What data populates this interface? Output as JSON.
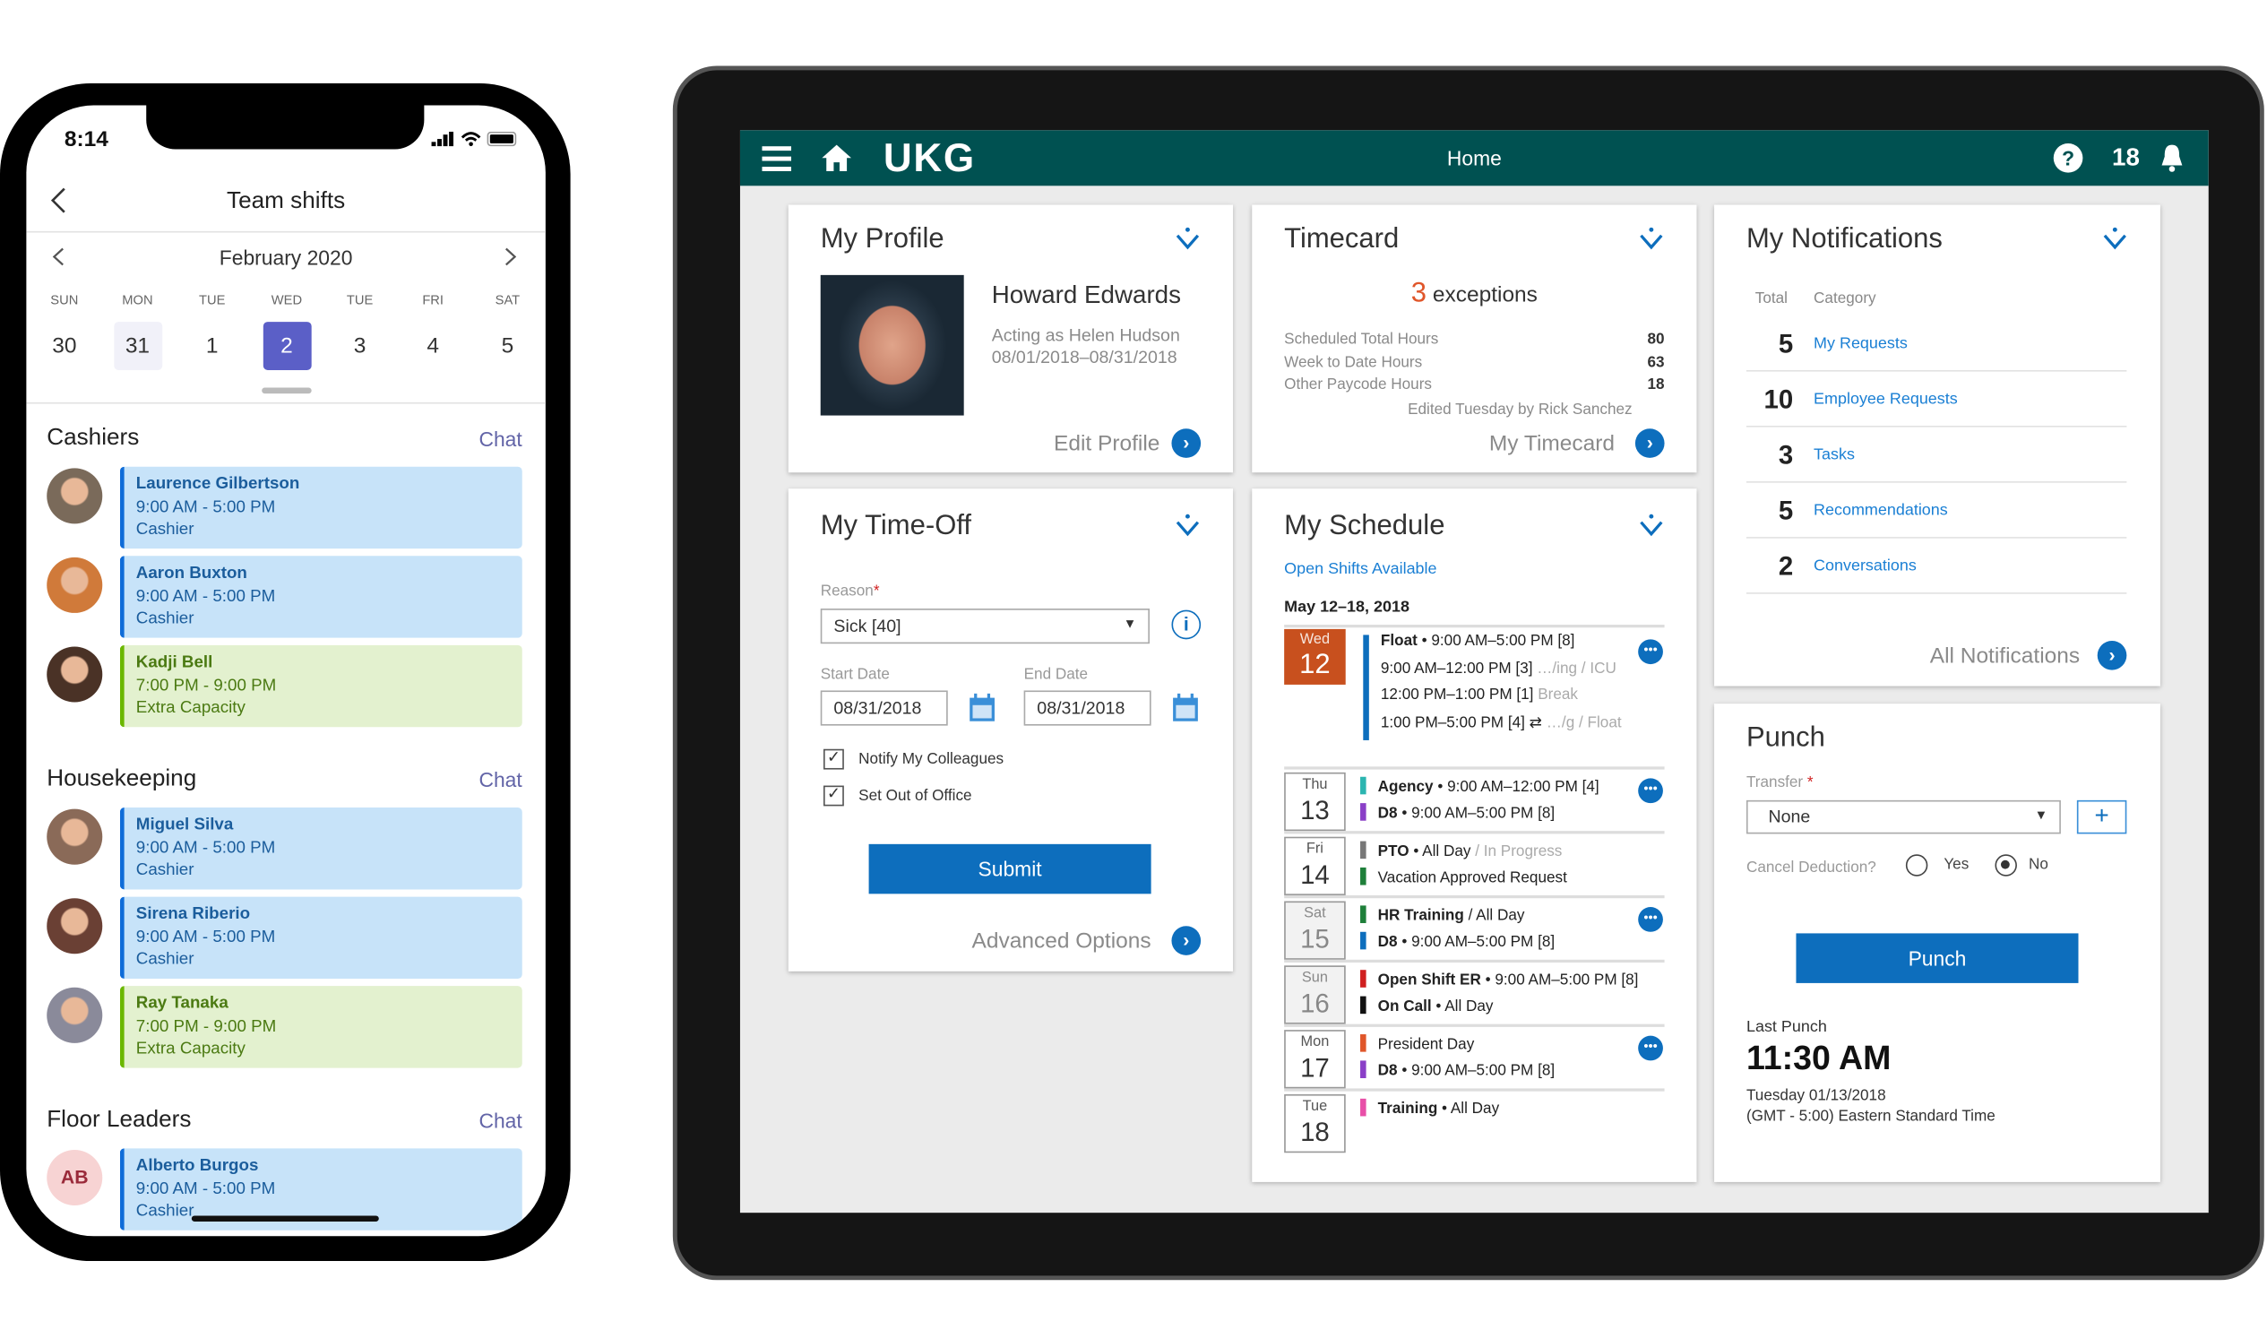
{
  "phone": {
    "status_time": "8:14",
    "title": "Team shifts",
    "month": "February 2020",
    "day_labels": [
      "SUN",
      "MON",
      "TUE",
      "WED",
      "TUE",
      "FRI",
      "SAT"
    ],
    "day_numbers": [
      "30",
      "31",
      "1",
      "2",
      "3",
      "4",
      "5"
    ],
    "selected_day": "2",
    "accent": "#5b5fc7",
    "groups": [
      {
        "name": "Cashiers",
        "chat": "Chat",
        "shifts": [
          {
            "name": "Laurence Gilbertson",
            "time": "9:00 AM - 5:00 PM",
            "role": "Cashier",
            "color": "blue"
          },
          {
            "name": "Aaron Buxton",
            "time": "9:00 AM - 5:00 PM",
            "role": "Cashier",
            "color": "blue"
          },
          {
            "name": "Kadji Bell",
            "time": "7:00 PM - 9:00 PM",
            "role": "Extra Capacity",
            "color": "green"
          }
        ]
      },
      {
        "name": "Housekeeping",
        "chat": "Chat",
        "shifts": [
          {
            "name": "Miguel Silva",
            "time": "9:00 AM - 5:00 PM",
            "role": "Cashier",
            "color": "blue"
          },
          {
            "name": "Sirena Riberio",
            "time": "9:00 AM - 5:00 PM",
            "role": "Cashier",
            "color": "blue"
          },
          {
            "name": "Ray Tanaka",
            "time": "7:00 PM - 9:00 PM",
            "role": "Extra Capacity",
            "color": "green"
          }
        ]
      },
      {
        "name": "Floor Leaders",
        "chat": "Chat",
        "shifts": [
          {
            "name": "Alberto Burgos",
            "time": "9:00 AM - 5:00 PM",
            "role": "Cashier",
            "color": "blue",
            "initials": "AB"
          }
        ]
      }
    ]
  },
  "tablet": {
    "header": {
      "logo": "UKG",
      "title": "Home",
      "notification_count": "18",
      "color": "#005151"
    },
    "profile": {
      "title": "My Profile",
      "name": "Howard Edwards",
      "acting": "Acting as Helen Hudson",
      "dates": "08/01/2018–08/31/2018",
      "link": "Edit Profile"
    },
    "timecard": {
      "title": "Timecard",
      "exceptions_count": "3",
      "exceptions_label": "exceptions",
      "rows": [
        {
          "label": "Scheduled Total Hours",
          "value": "80"
        },
        {
          "label": "Week to Date Hours",
          "value": "63"
        },
        {
          "label": "Other Paycode Hours",
          "value": "18"
        }
      ],
      "edited": "Edited Tuesday by Rick Sanchez",
      "link": "My Timecard"
    },
    "timeoff": {
      "title": "My Time-Off",
      "reason_label": "Reason",
      "reason_value": "Sick [40]",
      "start_label": "Start Date",
      "start_value": "08/31/2018",
      "end_label": "End Date",
      "end_value": "08/31/2018",
      "checkboxes": [
        {
          "label": "Notify My Colleagues",
          "checked": true
        },
        {
          "label": "Set Out of Office",
          "checked": true
        }
      ],
      "submit": "Submit",
      "advanced": "Advanced Options"
    },
    "schedule": {
      "title": "My Schedule",
      "open_shifts": "Open Shifts Available",
      "range": "May 12–18, 2018",
      "today": {
        "weekday": "Wed",
        "day": "12",
        "lines": [
          {
            "bold": "Float",
            "text": " • 9:00 AM–5:00 PM [8]"
          },
          {
            "bold": "",
            "text": "9:00 AM–12:00 PM [3]",
            "muted": " …/ing / ICU"
          },
          {
            "bold": "",
            "text": "12:00 PM–1:00 PM [1]",
            "muted": " Break"
          },
          {
            "bold": "",
            "text": "1:00 PM–5:00 PM [4] ⇄",
            "muted": " …/g / Float"
          }
        ]
      },
      "days": [
        {
          "weekday": "Thu",
          "day": "13",
          "more": true,
          "lines": [
            {
              "marker": "#2bb5b0",
              "bold": "Agency",
              "text": " • 9:00 AM–12:00 PM [4]"
            },
            {
              "marker": "#8a3fc7",
              "bold": "D8",
              "text": " • 9:00 AM–5:00 PM [8]"
            }
          ]
        },
        {
          "weekday": "Fri",
          "day": "14",
          "more": false,
          "lines": [
            {
              "marker": "#777",
              "bold": "PTO",
              "text": " • All Day",
              "muted": " / In Progress"
            },
            {
              "marker": "#1e7f3a",
              "bold": "",
              "text": "Vacation Approved Request"
            }
          ]
        },
        {
          "weekday": "Sat",
          "day": "15",
          "weekend": true,
          "more": true,
          "lines": [
            {
              "marker": "#1e7f3a",
              "bold": "HR Training",
              "text": " / All Day"
            },
            {
              "marker": "#0d6ebd",
              "bold": "D8",
              "text": " • 9:00 AM–5:00 PM [8]"
            }
          ]
        },
        {
          "weekday": "Sun",
          "day": "16",
          "weekend": true,
          "more": false,
          "lines": [
            {
              "marker": "#d01f1f",
              "bold": "Open Shift ER",
              "text": " • 9:00 AM–5:00 PM [8]"
            },
            {
              "marker": "#111",
              "bold": "On Call",
              "text": " • All Day"
            }
          ]
        },
        {
          "weekday": "Mon",
          "day": "17",
          "more": true,
          "lines": [
            {
              "marker": "#e0562a",
              "bold": "",
              "text": "President Day"
            },
            {
              "marker": "#8a3fc7",
              "bold": "D8",
              "text": " • 9:00 AM–5:00 PM [8]"
            }
          ]
        },
        {
          "weekday": "Tue",
          "day": "18",
          "more": false,
          "lines": [
            {
              "marker": "#e84fa8",
              "bold": "Training",
              "text": " • All Day"
            }
          ]
        }
      ]
    },
    "notifications": {
      "title": "My Notifications",
      "col_total": "Total",
      "col_category": "Category",
      "rows": [
        {
          "count": "5",
          "category": "My Requests"
        },
        {
          "count": "10",
          "category": "Employee Requests"
        },
        {
          "count": "3",
          "category": "Tasks"
        },
        {
          "count": "5",
          "category": "Recommendations"
        },
        {
          "count": "2",
          "category": "Conversations"
        }
      ],
      "link": "All Notifications"
    },
    "punch": {
      "title": "Punch",
      "transfer_label": "Transfer",
      "transfer_value": "None",
      "cancel_label": "Cancel Deduction?",
      "yes": "Yes",
      "no": "No",
      "selected": "No",
      "button": "Punch",
      "last_label": "Last Punch",
      "last_time": "11:30 AM",
      "last_date": "Tuesday 01/13/2018",
      "timezone": "(GMT - 5:00) Eastern Standard Time"
    }
  }
}
